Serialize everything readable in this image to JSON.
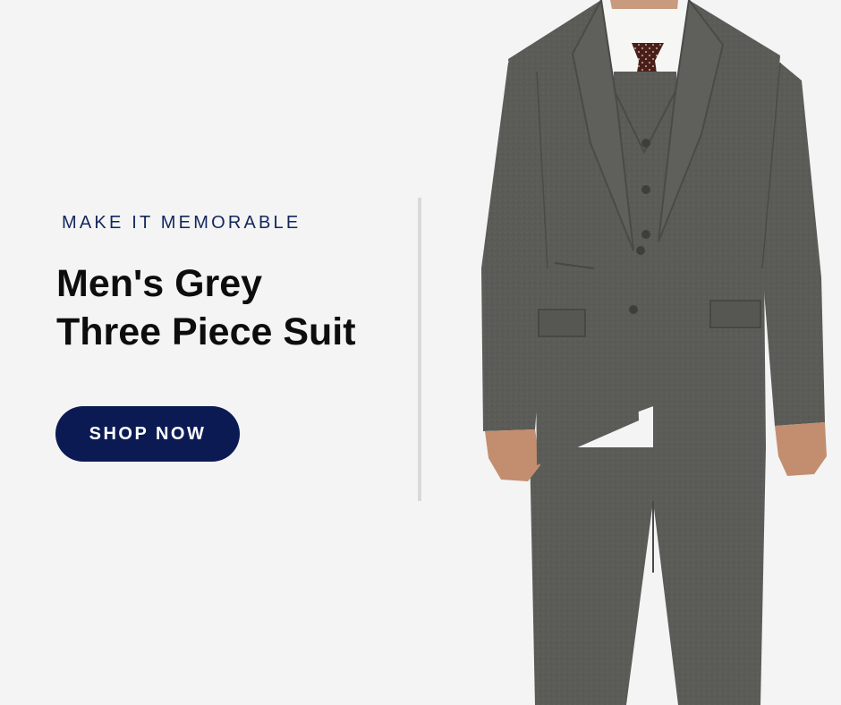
{
  "banner": {
    "tagline": "MAKE IT MEMORABLE",
    "headline_line1": "Men's Grey",
    "headline_line2": "Three Piece Suit",
    "cta_label": "SHOP NOW"
  },
  "colors": {
    "background": "#f4f4f4",
    "accent_navy": "#0c1a54",
    "tagline_navy": "#13265e",
    "headline": "#0d0d0d",
    "suit_grey": "#5a5b56"
  }
}
